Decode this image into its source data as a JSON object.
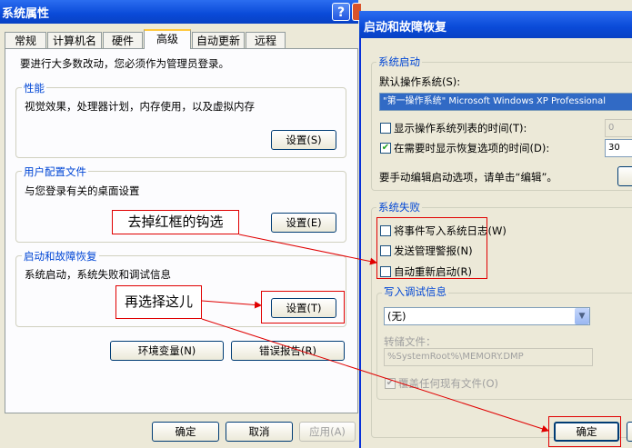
{
  "left_dialog": {
    "title": "系统属性",
    "tabs": [
      "常规",
      "计算机名",
      "硬件",
      "高级",
      "自动更新",
      "远程"
    ],
    "admin_note": "要进行大多数改动，您必须作为管理员登录。",
    "performance": {
      "legend": "性能",
      "text": "视觉效果，处理器计划，内存使用，以及虚拟内存",
      "button": "设置(S)"
    },
    "user_profiles": {
      "legend": "用户配置文件",
      "text": "与您登录有关的桌面设置",
      "button": "设置(E)"
    },
    "startup_recovery": {
      "legend": "启动和故障恢复",
      "text": "系统启动，系统失败和调试信息",
      "button": "设置(T)"
    },
    "env_button": "环境变量(N)",
    "error_report_button": "错误报告(R)",
    "ok": "确定",
    "cancel": "取消",
    "apply": "应用(A)"
  },
  "right_dialog": {
    "title": "启动和故障恢复",
    "system_startup": {
      "legend": "系统启动",
      "default_os_label": "默认操作系统(S):",
      "default_os_value": "\"第一操作系统\" Microsoft Windows XP Professional",
      "show_list_label": "显示操作系统列表的时间(T):",
      "show_list_value": "0",
      "show_recovery_label": "在需要时显示恢复选项的时间(D):",
      "show_recovery_value": "30",
      "edit_note": "要手动编辑启动选项，请单击“编辑”。"
    },
    "system_failure": {
      "legend": "系统失败",
      "write_event": "将事件写入系统日志(W)",
      "send_alert": "发送管理警报(N)",
      "auto_restart": "自动重新启动(R)"
    },
    "debug_info": {
      "legend": "写入调试信息",
      "select_value": "(无)",
      "dump_file_label": "转储文件：",
      "dump_file_value": "%SystemRoot%\\MEMORY.DMP",
      "overwrite": "覆盖任何现有文件(O)"
    },
    "ok": "确定"
  },
  "annotations": {
    "note1": "去掉红框的钩选",
    "note2": "再选择这儿"
  },
  "colors": {
    "title_bar": "#0a4ad8",
    "annotation_red": "#e00000",
    "group_legend": "#0046d5"
  }
}
